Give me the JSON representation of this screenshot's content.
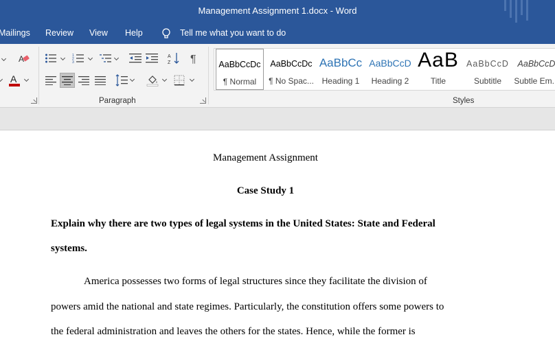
{
  "window": {
    "title": "Management Assignment 1.docx  -  Word"
  },
  "menu": {
    "tabs": [
      "Mailings",
      "Review",
      "View",
      "Help"
    ],
    "tell_me": "Tell me what you want to do"
  },
  "ribbon": {
    "paragraph_group_label": "Paragraph",
    "styles_group_label": "Styles",
    "styles": [
      {
        "preview": "AaBbCcDc",
        "name": "¶ Normal",
        "selected": true
      },
      {
        "preview": "AaBbCcDc",
        "name": "¶ No Spac..."
      },
      {
        "preview": "AaBbCc",
        "name": "Heading 1"
      },
      {
        "preview": "AaBbCcD",
        "name": "Heading 2"
      },
      {
        "preview": "AaB",
        "name": "Title"
      },
      {
        "preview": "AaBbCcD",
        "name": "Subtitle"
      },
      {
        "preview": "AaBbCcD",
        "name": "Subtle Em..."
      }
    ],
    "colors": {
      "font_color": "#c00000",
      "accent": "#2b579a"
    }
  },
  "document": {
    "title": "Management Assignment",
    "heading": "Case Study 1",
    "question_line1": "Explain why there are two types of legal systems in the United States: State and Federal",
    "question_line2": "systems.",
    "body_line1": "America possesses two forms of legal structures since they facilitate the division of",
    "body_line2": "powers amid the national and state regimes. Particularly, the constitution offers some powers to",
    "body_line3": "the federal administration and leaves the others for the states. Hence, while the former is"
  }
}
